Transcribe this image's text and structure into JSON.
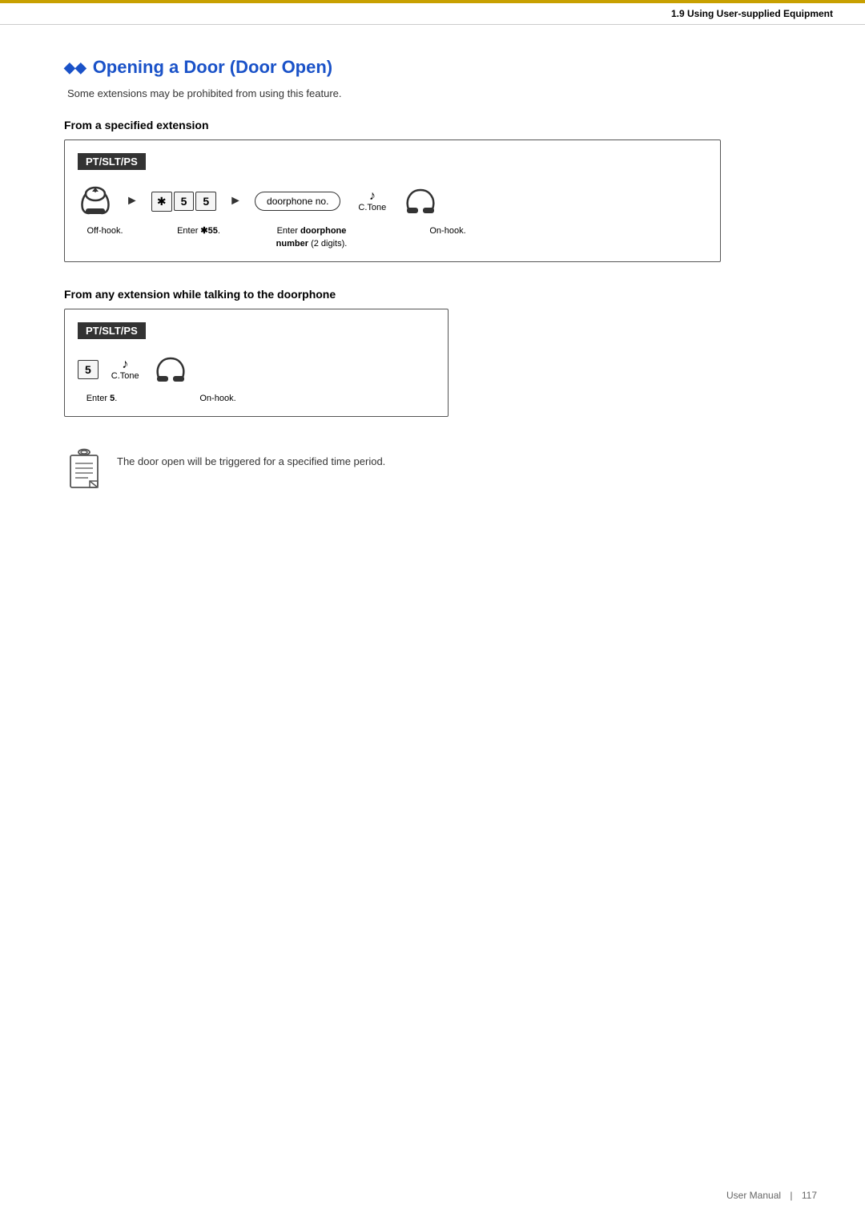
{
  "header": {
    "section": "1.9 Using User-supplied Equipment"
  },
  "page": {
    "title_diamonds": "◆◆",
    "title_text": "Opening a Door (Door Open)",
    "subtitle": "Some extensions may be prohibited from using this feature.",
    "section1_heading": "From a specified extension",
    "section2_heading": "From any extension while talking to the doorphone",
    "box_label": "PT/SLT/PS",
    "note_text": "The door open will be triggered for a specified time period."
  },
  "flow1": {
    "labels": {
      "offhook": "Off-hook.",
      "enter55": "Enter ✱55.",
      "doorphone": "Enter doorphone\nnumber (2 digits).",
      "onhook": "On-hook."
    },
    "keys": {
      "star": "✱",
      "five1": "5",
      "five2": "5",
      "doorphone_placeholder": "doorphone no.",
      "ctone": "C.Tone"
    }
  },
  "flow2": {
    "labels": {
      "enter5": "Enter 5.",
      "onhook": "On-hook."
    },
    "keys": {
      "five": "5",
      "ctone": "C.Tone"
    }
  },
  "footer": {
    "label": "User Manual",
    "page": "117"
  }
}
